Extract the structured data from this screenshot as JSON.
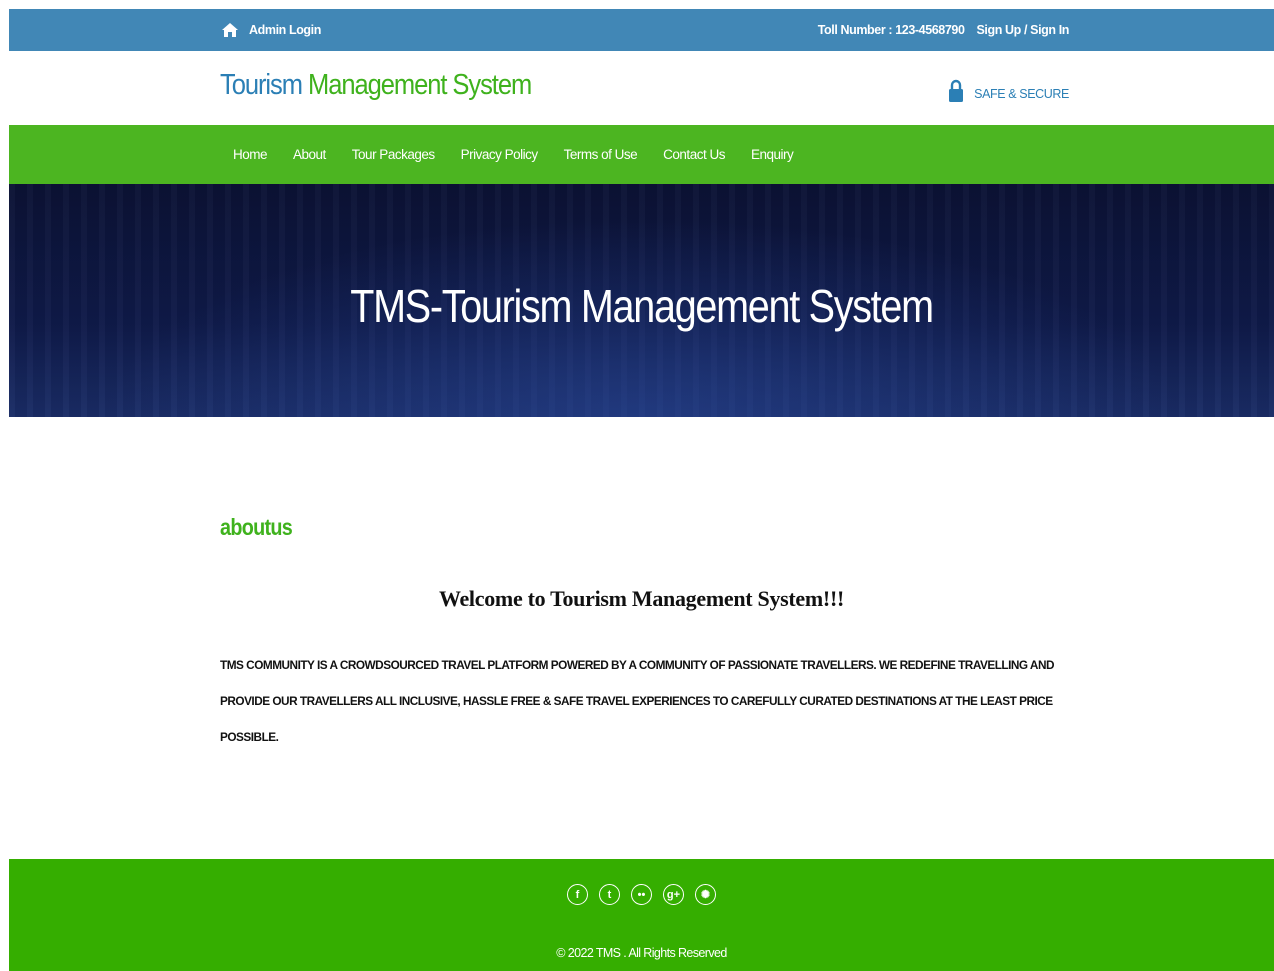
{
  "topbar": {
    "admin_label": "Admin Login",
    "toll": "Toll Number : 123-4568790",
    "signup": "Sign Up / Sign In"
  },
  "header": {
    "logo_part1": "Tourism",
    "logo_part2": "Management System",
    "secure_text": "SAFE & SECURE"
  },
  "nav": {
    "items": [
      "Home",
      "About",
      "Tour Packages",
      "Privacy Policy",
      "Terms of Use",
      "Contact Us",
      "Enquiry"
    ]
  },
  "banner": {
    "title": "TMS-Tourism Management System"
  },
  "about": {
    "heading": "aboutus",
    "welcome": "Welcome to Tourism Management System!!!",
    "description": "TMS  COMMUNITY IS A CROWDSOURCED TRAVEL PLATFORM POWERED BY A COMMUNITY OF PASSIONATE TRAVELLERS. WE REDEFINE TRAVELLING AND PROVIDE OUR TRAVELLERS ALL INCLUSIVE, HASSLE FREE & SAFE TRAVEL EXPERIENCES TO CAREFULLY CURATED DESTINATIONS AT THE LEAST PRICE POSSIBLE."
  },
  "footer": {
    "socials": [
      {
        "icon": "facebook-icon",
        "glyph": "f"
      },
      {
        "icon": "twitter-icon",
        "glyph": "t"
      },
      {
        "icon": "flickr-icon",
        "glyph": "••"
      },
      {
        "icon": "google-plus-icon",
        "glyph": "g+"
      },
      {
        "icon": "dribbble-icon",
        "glyph": "✺"
      }
    ],
    "copyright": "© 2022 TMS . All Rights Reserved"
  },
  "colors": {
    "topbar": "#4187b6",
    "nav": "#4cb521",
    "footer": "#35ae00",
    "logo_blue": "#2b7fb5",
    "logo_green": "#3fb21d"
  }
}
